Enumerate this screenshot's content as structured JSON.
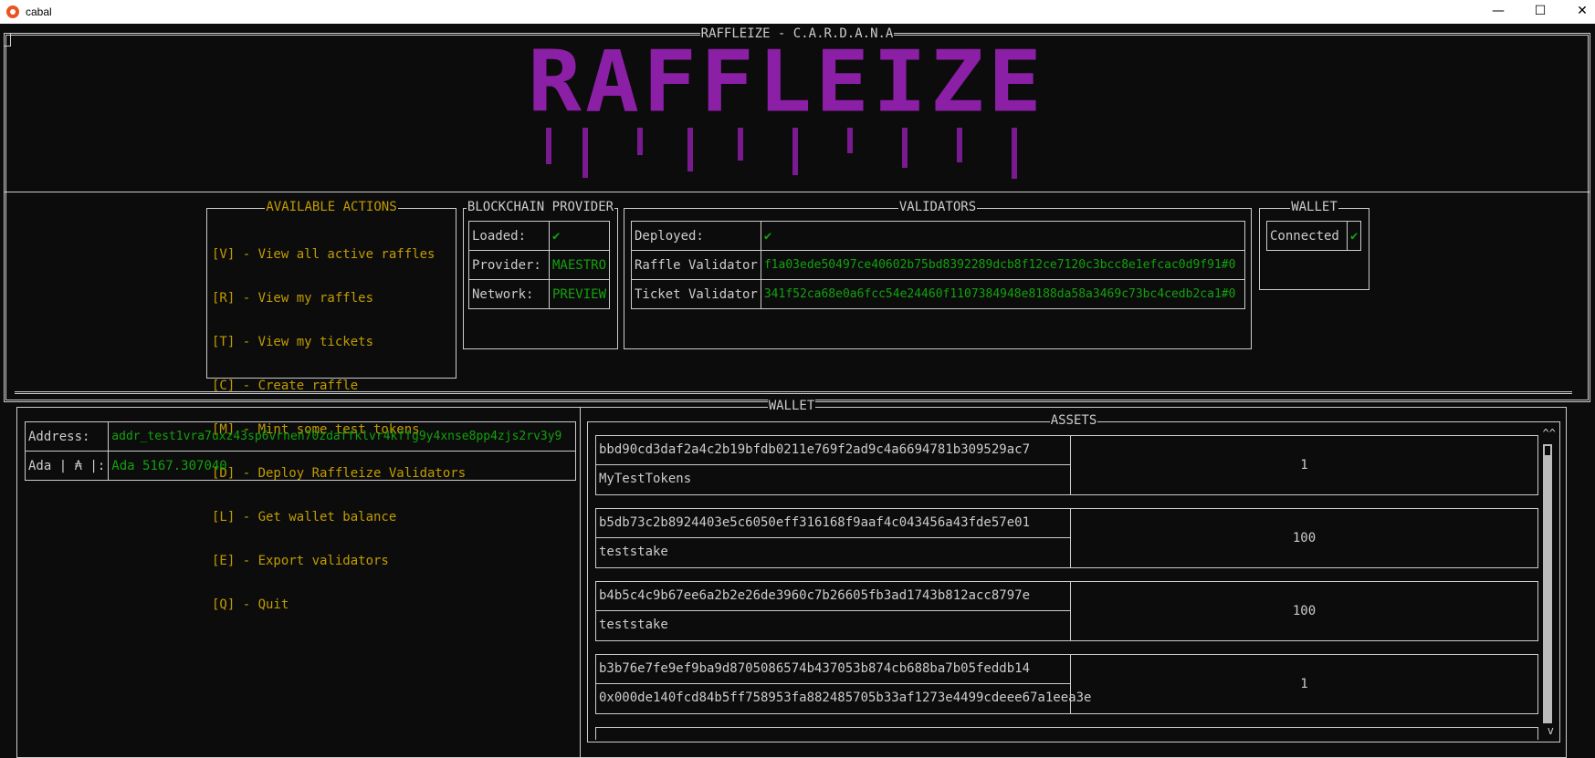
{
  "window": {
    "title": "cabal",
    "minimize": "—",
    "maximize": "☐",
    "close": "✕"
  },
  "header": {
    "title": "RAFFLEIZE - C.A.R.D.A.N.A",
    "logo_text": "RAFFLEIZE"
  },
  "actions": {
    "title": "AVAILABLE ACTIONS",
    "items": [
      "[V] - View all active raffles",
      "[R] - View my raffles",
      "[T] - View my tickets",
      "[C] - Create raffle",
      "[M] - Mint some test tokens",
      "[D] - Deploy Raffleize Validators",
      "[L] - Get wallet balance",
      "[E] - Export validators",
      "[Q] - Quit"
    ]
  },
  "provider": {
    "title": "BLOCKCHAIN PROVIDER",
    "loaded_label": "Loaded:",
    "loaded_value": "✔",
    "provider_label": "Provider:",
    "provider_value": "MAESTRO",
    "network_label": "Network:",
    "network_value": "PREVIEW"
  },
  "validators": {
    "title": "VALIDATORS",
    "deployed_label": "Deployed:",
    "deployed_value": "✔",
    "raffle_label": "Raffle Validator",
    "raffle_value": "f1a03ede50497ce40602b75bd8392289dcb8f12ce7120c3bcc8e1efcac0d9f91#0",
    "ticket_label": "Ticket Validator",
    "ticket_value": "341f52ca68e0a6fcc54e24460f1107384948e8188da58a3469c73bc4cedb2ca1#0"
  },
  "wallet_status": {
    "title": "WALLET",
    "label": "Connected",
    "value": "✔"
  },
  "wallet": {
    "title": "WALLET",
    "address_label": "Address:",
    "address_value": "addr_test1vra7uxz43sp6vrnen70zdaffklvr4kffg9y4xnse8pp4zjs2rv3y9",
    "ada_label": "Ada | ₳ |:",
    "ada_value": "Ada 5167.307040"
  },
  "assets": {
    "title": "ASSETS",
    "items": [
      {
        "policy": "bbd90cd3daf2a4c2b19bfdb0211e769f2ad9c4a6694781b309529ac7",
        "name": "MyTestTokens",
        "qty": "1"
      },
      {
        "policy": "b5db73c2b8924403e5c6050eff316168f9aaf4c043456a43fde57e01",
        "name": "teststake",
        "qty": "100"
      },
      {
        "policy": "b4b5c4c9b67ee6a2b2e26de3960c7b26605fb3ad1743b812acc8797e",
        "name": "teststake",
        "qty": "100"
      },
      {
        "policy": "b3b76e7fe9ef9ba9d8705086574b437053b874cb688ba7b05feddb14",
        "name": "0x000de140fcd84b5ff758953fa882485705b33af1273e4499cdeee67a1eea3e",
        "qty": "1"
      }
    ],
    "scroll_up": "^^",
    "scroll_down": "v"
  },
  "colors": {
    "accent_yellow": "#c19c00",
    "value_green": "#13a10e",
    "logo_purple": "#8b1fa5",
    "background": "#0c0c0c"
  }
}
